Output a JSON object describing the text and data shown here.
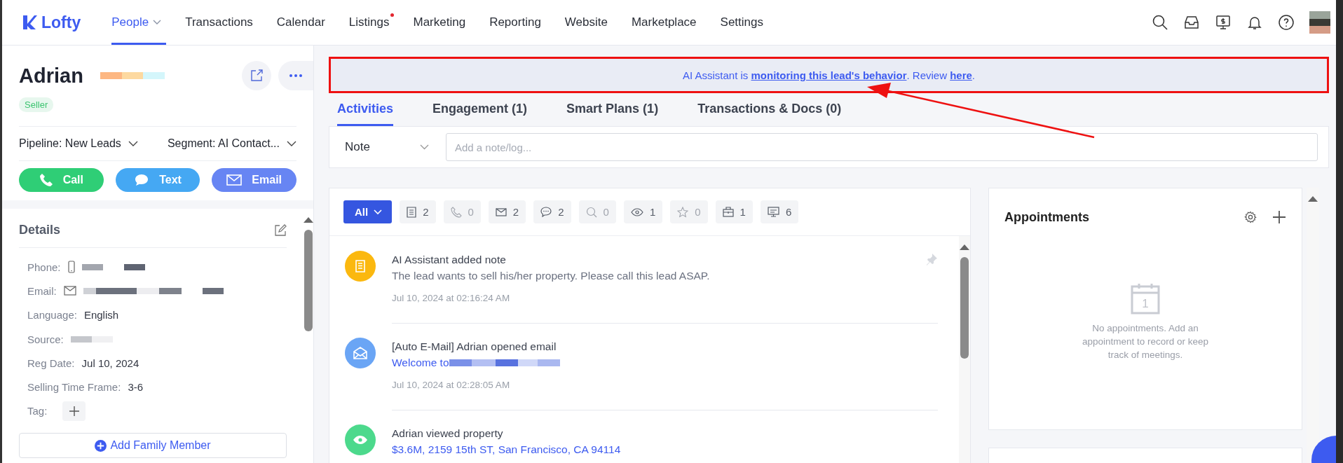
{
  "nav": {
    "logo": "Lofty",
    "items": [
      {
        "label": "People",
        "selected": true,
        "dropdown": true,
        "dot": false
      },
      {
        "label": "Transactions",
        "selected": false,
        "dropdown": false,
        "dot": false
      },
      {
        "label": "Calendar",
        "selected": false,
        "dropdown": false,
        "dot": false
      },
      {
        "label": "Listings",
        "selected": false,
        "dropdown": false,
        "dot": true
      },
      {
        "label": "Marketing",
        "selected": false,
        "dropdown": false,
        "dot": false
      },
      {
        "label": "Reporting",
        "selected": false,
        "dropdown": false,
        "dot": false
      },
      {
        "label": "Website",
        "selected": false,
        "dropdown": false,
        "dot": false
      },
      {
        "label": "Marketplace",
        "selected": false,
        "dropdown": false,
        "dot": false
      },
      {
        "label": "Settings",
        "selected": false,
        "dropdown": false,
        "dot": false
      }
    ]
  },
  "lead": {
    "name": "Adrian",
    "tag": "Seller",
    "pipeline": "Pipeline: New Leads",
    "segment": "Segment: AI Contact...",
    "actions": [
      {
        "kind": "call",
        "label": "Call"
      },
      {
        "kind": "text",
        "label": "Text"
      },
      {
        "kind": "email",
        "label": "Email"
      }
    ]
  },
  "details": {
    "title": "Details",
    "fields": [
      {
        "kind": "phone",
        "label": "Phone:"
      },
      {
        "kind": "email",
        "label": "Email:"
      },
      {
        "kind": "text",
        "label": "Language:",
        "value": "English"
      },
      {
        "kind": "hidden",
        "label": "Source:"
      },
      {
        "kind": "text",
        "label": "Reg Date:",
        "value": "Jul 10, 2024"
      },
      {
        "kind": "text",
        "label": "Selling Time Frame:",
        "value": "3-6"
      },
      {
        "kind": "tag",
        "label": "Tag:"
      }
    ],
    "add_family": "Add Family Member"
  },
  "banner": {
    "segments": [
      {
        "kind": "text",
        "text": "AI Assistant is "
      },
      {
        "kind": "link",
        "text": "monitoring this lead's behavior"
      },
      {
        "kind": "text",
        "text": ". Review "
      },
      {
        "kind": "link",
        "text": "here"
      },
      {
        "kind": "text",
        "text": "."
      }
    ]
  },
  "tabs": [
    {
      "label": "Activities",
      "selected": true
    },
    {
      "label": "Engagement (1)",
      "selected": false
    },
    {
      "label": "Smart Plans (1)",
      "selected": false
    },
    {
      "label": "Transactions & Docs (0)",
      "selected": false
    }
  ],
  "note": {
    "type": "Note",
    "placeholder": "Add a note/log..."
  },
  "filters": {
    "all": "All",
    "chips": [
      {
        "kind": "note",
        "count": "2",
        "dimmed": false
      },
      {
        "kind": "phone",
        "count": "0",
        "dimmed": true
      },
      {
        "kind": "email",
        "count": "2",
        "dimmed": false
      },
      {
        "kind": "chat",
        "count": "2",
        "dimmed": false
      },
      {
        "kind": "search",
        "count": "0",
        "dimmed": true
      },
      {
        "kind": "view",
        "count": "1",
        "dimmed": false
      },
      {
        "kind": "star",
        "count": "0",
        "dimmed": true
      },
      {
        "kind": "case",
        "count": "1",
        "dimmed": false
      },
      {
        "kind": "monitor",
        "count": "6",
        "dimmed": false
      }
    ]
  },
  "activities": [
    {
      "kind": "note",
      "color": "#fbb80f",
      "title": "AI Assistant added note",
      "detail": "The lead wants to sell his/her property. Please call this lead ASAP.",
      "detail_link": false,
      "hidden_tail": false,
      "time": "Jul 10, 2024 at 02:16:24 AM",
      "pinned": true
    },
    {
      "kind": "email",
      "color": "#6aa5f5",
      "title": "[Auto E-Mail] Adrian opened email",
      "detail": "Welcome to",
      "detail_link": true,
      "hidden_tail": true,
      "time": "Jul 10, 2024 at 02:28:05 AM",
      "pinned": false
    },
    {
      "kind": "view",
      "color": "#4cd98c",
      "title": "Adrian viewed property",
      "detail": "$3.6M, 2159 15th ST, San Francisco, CA 94114",
      "detail_link": true,
      "hidden_tail": false,
      "pinned": false
    }
  ],
  "appointments": {
    "title": "Appointments",
    "calendar_day": "1",
    "empty_text": "No appointments. Add an appointment to record or keep track of meetings."
  }
}
